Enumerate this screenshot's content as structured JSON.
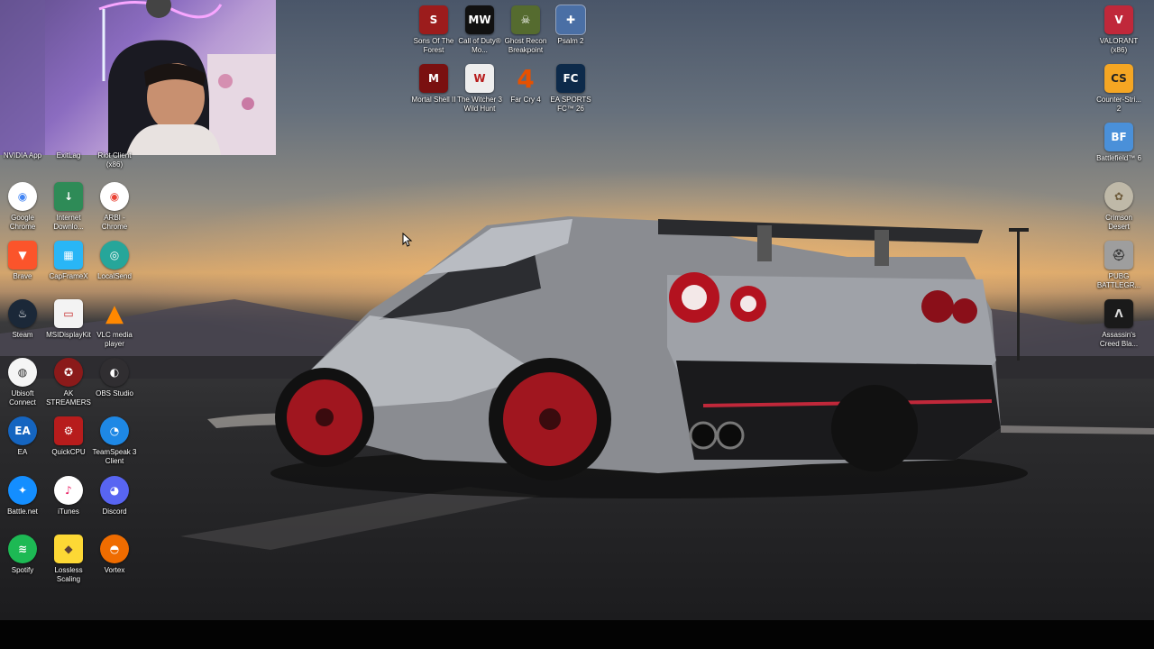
{
  "desktop": {
    "left_icons_partial": [
      {
        "label": "NVIDIA App",
        "icon": "nvidia-icon",
        "color": "#76b900"
      },
      {
        "label": "ExitLag",
        "icon": "exitlag-icon",
        "color": "#1e88e5"
      },
      {
        "label": "Riot Client (x86)",
        "icon": "riot-client-icon",
        "color": "#d13639"
      }
    ],
    "left_icons": [
      {
        "label": "Google Chrome",
        "icon": "chrome-icon",
        "color": "#4285f4",
        "glyph": "◉"
      },
      {
        "label": "Internet Downlo...",
        "icon": "idm-icon",
        "color": "#2e8b57",
        "glyph": "↓"
      },
      {
        "label": "ARBI - Chrome",
        "icon": "chrome-profile-icon",
        "color": "#ea4335",
        "glyph": "◉"
      },
      {
        "label": "Brave",
        "icon": "brave-icon",
        "color": "#fb542b",
        "glyph": "▼"
      },
      {
        "label": "CapFrameX",
        "icon": "capframex-icon",
        "color": "#29b6f6",
        "glyph": "▦"
      },
      {
        "label": "LocalSend",
        "icon": "localsend-icon",
        "color": "#26a69a",
        "glyph": "◎"
      },
      {
        "label": "Steam",
        "icon": "steam-icon",
        "color": "#1b2838",
        "glyph": "♨"
      },
      {
        "label": "MSIDisplayKit",
        "icon": "msi-displaykit-icon",
        "color": "#c62828",
        "glyph": "▭"
      },
      {
        "label": "VLC media player",
        "icon": "vlc-icon",
        "color": "#ff8800",
        "glyph": "▲"
      },
      {
        "label": "Ubisoft Connect",
        "icon": "ubisoft-icon",
        "color": "#2a2a2a",
        "glyph": "◍"
      },
      {
        "label": "AK STREAMERS",
        "icon": "ak-streamers-icon",
        "color": "#8b1a1a",
        "glyph": "✪"
      },
      {
        "label": "OBS Studio",
        "icon": "obs-icon",
        "color": "#302e31",
        "glyph": "◐"
      },
      {
        "label": "EA",
        "icon": "ea-icon",
        "color": "#1565c0",
        "glyph": "EA"
      },
      {
        "label": "QuickCPU",
        "icon": "quickcpu-icon",
        "color": "#b71c1c",
        "glyph": "⚙"
      },
      {
        "label": "TeamSpeak 3 Client",
        "icon": "teamspeak-icon",
        "color": "#1e88e5",
        "glyph": "◔"
      },
      {
        "label": "Battle.net",
        "icon": "battlenet-icon",
        "color": "#148eff",
        "glyph": "✦"
      },
      {
        "label": "iTunes",
        "icon": "itunes-icon",
        "color": "#e91e63",
        "glyph": "♪"
      },
      {
        "label": "Discord",
        "icon": "discord-icon",
        "color": "#5865f2",
        "glyph": "◕"
      },
      {
        "label": "Spotify",
        "icon": "spotify-icon",
        "color": "#1db954",
        "glyph": "≋"
      },
      {
        "label": "Lossless Scaling",
        "icon": "lossless-scaling-icon",
        "color": "#fdd835",
        "glyph": "◆"
      },
      {
        "label": "Vortex",
        "icon": "vortex-icon",
        "color": "#ef6c00",
        "glyph": "◓"
      }
    ],
    "top_icons": [
      {
        "label": "Sons Of The Forest",
        "icon": "sons-of-the-forest-icon",
        "color": "#9c1c1c",
        "glyph": "S"
      },
      {
        "label": "Call of Duty® Mo...",
        "icon": "call-of-duty-icon",
        "color": "#111111",
        "glyph": "MW"
      },
      {
        "label": "Ghost Recon Breakpoint",
        "icon": "ghost-recon-icon",
        "color": "#556b2f",
        "glyph": "☠"
      },
      {
        "label": "Psalm 2",
        "icon": "psalm2-icon",
        "color": "#4a6fa5",
        "glyph": "✚"
      },
      {
        "label": "Mortal Shell II",
        "icon": "mortal-shell-icon",
        "color": "#7a1010",
        "glyph": "M"
      },
      {
        "label": "The Witcher 3 Wild Hunt",
        "icon": "witcher3-icon",
        "color": "#eeeeee",
        "glyph": "W"
      },
      {
        "label": "Far Cry 4",
        "icon": "far-cry-4-icon",
        "color": "#e65100",
        "glyph": "4"
      },
      {
        "label": "EA SPORTS FC™ 26",
        "icon": "ea-fc26-icon",
        "color": "#0d2a4a",
        "glyph": "FC"
      }
    ],
    "right_icons": [
      {
        "label": "VALORANT (x86)",
        "icon": "valorant-icon",
        "color": "#c0283a",
        "glyph": "V"
      },
      {
        "label": "Counter-Stri... 2",
        "icon": "counter-strike-icon",
        "color": "#f5a623",
        "glyph": "CS"
      },
      {
        "label": "Battlefield™ 6",
        "icon": "battlefield-icon",
        "color": "#4a90d9",
        "glyph": "BF"
      },
      {
        "label": "Crimson Desert",
        "icon": "crimson-desert-icon",
        "color": "#bfb9a8",
        "glyph": "✿"
      },
      {
        "label": "PUBG BATTLEGR...",
        "icon": "pubg-icon",
        "color": "#9e9e9e",
        "glyph": "⛑"
      },
      {
        "label": "Assassin's Creed Bla...",
        "icon": "assassins-creed-icon",
        "color": "#1a1a1a",
        "glyph": "Λ"
      }
    ]
  }
}
